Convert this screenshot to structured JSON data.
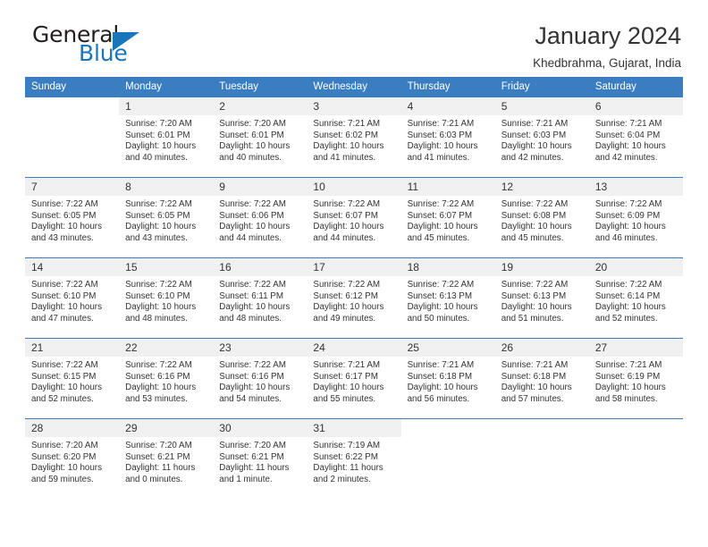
{
  "brand": {
    "name_part1": "General",
    "name_part2": "Blue"
  },
  "header": {
    "title": "January 2024",
    "subtitle": "Khedbrahma, Gujarat, India"
  },
  "colors": {
    "header_blue": "#3a7ec1",
    "brand_blue": "#1b75bb",
    "daynum_bg": "#f0f0f0",
    "text": "#333333"
  },
  "weekdays": [
    "Sunday",
    "Monday",
    "Tuesday",
    "Wednesday",
    "Thursday",
    "Friday",
    "Saturday"
  ],
  "weeks": [
    [
      {
        "day": "",
        "sunrise": "",
        "sunset": "",
        "daylight1": "",
        "daylight2": ""
      },
      {
        "day": "1",
        "sunrise": "Sunrise: 7:20 AM",
        "sunset": "Sunset: 6:01 PM",
        "daylight1": "Daylight: 10 hours",
        "daylight2": "and 40 minutes."
      },
      {
        "day": "2",
        "sunrise": "Sunrise: 7:20 AM",
        "sunset": "Sunset: 6:01 PM",
        "daylight1": "Daylight: 10 hours",
        "daylight2": "and 40 minutes."
      },
      {
        "day": "3",
        "sunrise": "Sunrise: 7:21 AM",
        "sunset": "Sunset: 6:02 PM",
        "daylight1": "Daylight: 10 hours",
        "daylight2": "and 41 minutes."
      },
      {
        "day": "4",
        "sunrise": "Sunrise: 7:21 AM",
        "sunset": "Sunset: 6:03 PM",
        "daylight1": "Daylight: 10 hours",
        "daylight2": "and 41 minutes."
      },
      {
        "day": "5",
        "sunrise": "Sunrise: 7:21 AM",
        "sunset": "Sunset: 6:03 PM",
        "daylight1": "Daylight: 10 hours",
        "daylight2": "and 42 minutes."
      },
      {
        "day": "6",
        "sunrise": "Sunrise: 7:21 AM",
        "sunset": "Sunset: 6:04 PM",
        "daylight1": "Daylight: 10 hours",
        "daylight2": "and 42 minutes."
      }
    ],
    [
      {
        "day": "7",
        "sunrise": "Sunrise: 7:22 AM",
        "sunset": "Sunset: 6:05 PM",
        "daylight1": "Daylight: 10 hours",
        "daylight2": "and 43 minutes."
      },
      {
        "day": "8",
        "sunrise": "Sunrise: 7:22 AM",
        "sunset": "Sunset: 6:05 PM",
        "daylight1": "Daylight: 10 hours",
        "daylight2": "and 43 minutes."
      },
      {
        "day": "9",
        "sunrise": "Sunrise: 7:22 AM",
        "sunset": "Sunset: 6:06 PM",
        "daylight1": "Daylight: 10 hours",
        "daylight2": "and 44 minutes."
      },
      {
        "day": "10",
        "sunrise": "Sunrise: 7:22 AM",
        "sunset": "Sunset: 6:07 PM",
        "daylight1": "Daylight: 10 hours",
        "daylight2": "and 44 minutes."
      },
      {
        "day": "11",
        "sunrise": "Sunrise: 7:22 AM",
        "sunset": "Sunset: 6:07 PM",
        "daylight1": "Daylight: 10 hours",
        "daylight2": "and 45 minutes."
      },
      {
        "day": "12",
        "sunrise": "Sunrise: 7:22 AM",
        "sunset": "Sunset: 6:08 PM",
        "daylight1": "Daylight: 10 hours",
        "daylight2": "and 45 minutes."
      },
      {
        "day": "13",
        "sunrise": "Sunrise: 7:22 AM",
        "sunset": "Sunset: 6:09 PM",
        "daylight1": "Daylight: 10 hours",
        "daylight2": "and 46 minutes."
      }
    ],
    [
      {
        "day": "14",
        "sunrise": "Sunrise: 7:22 AM",
        "sunset": "Sunset: 6:10 PM",
        "daylight1": "Daylight: 10 hours",
        "daylight2": "and 47 minutes."
      },
      {
        "day": "15",
        "sunrise": "Sunrise: 7:22 AM",
        "sunset": "Sunset: 6:10 PM",
        "daylight1": "Daylight: 10 hours",
        "daylight2": "and 48 minutes."
      },
      {
        "day": "16",
        "sunrise": "Sunrise: 7:22 AM",
        "sunset": "Sunset: 6:11 PM",
        "daylight1": "Daylight: 10 hours",
        "daylight2": "and 48 minutes."
      },
      {
        "day": "17",
        "sunrise": "Sunrise: 7:22 AM",
        "sunset": "Sunset: 6:12 PM",
        "daylight1": "Daylight: 10 hours",
        "daylight2": "and 49 minutes."
      },
      {
        "day": "18",
        "sunrise": "Sunrise: 7:22 AM",
        "sunset": "Sunset: 6:13 PM",
        "daylight1": "Daylight: 10 hours",
        "daylight2": "and 50 minutes."
      },
      {
        "day": "19",
        "sunrise": "Sunrise: 7:22 AM",
        "sunset": "Sunset: 6:13 PM",
        "daylight1": "Daylight: 10 hours",
        "daylight2": "and 51 minutes."
      },
      {
        "day": "20",
        "sunrise": "Sunrise: 7:22 AM",
        "sunset": "Sunset: 6:14 PM",
        "daylight1": "Daylight: 10 hours",
        "daylight2": "and 52 minutes."
      }
    ],
    [
      {
        "day": "21",
        "sunrise": "Sunrise: 7:22 AM",
        "sunset": "Sunset: 6:15 PM",
        "daylight1": "Daylight: 10 hours",
        "daylight2": "and 52 minutes."
      },
      {
        "day": "22",
        "sunrise": "Sunrise: 7:22 AM",
        "sunset": "Sunset: 6:16 PM",
        "daylight1": "Daylight: 10 hours",
        "daylight2": "and 53 minutes."
      },
      {
        "day": "23",
        "sunrise": "Sunrise: 7:22 AM",
        "sunset": "Sunset: 6:16 PM",
        "daylight1": "Daylight: 10 hours",
        "daylight2": "and 54 minutes."
      },
      {
        "day": "24",
        "sunrise": "Sunrise: 7:21 AM",
        "sunset": "Sunset: 6:17 PM",
        "daylight1": "Daylight: 10 hours",
        "daylight2": "and 55 minutes."
      },
      {
        "day": "25",
        "sunrise": "Sunrise: 7:21 AM",
        "sunset": "Sunset: 6:18 PM",
        "daylight1": "Daylight: 10 hours",
        "daylight2": "and 56 minutes."
      },
      {
        "day": "26",
        "sunrise": "Sunrise: 7:21 AM",
        "sunset": "Sunset: 6:18 PM",
        "daylight1": "Daylight: 10 hours",
        "daylight2": "and 57 minutes."
      },
      {
        "day": "27",
        "sunrise": "Sunrise: 7:21 AM",
        "sunset": "Sunset: 6:19 PM",
        "daylight1": "Daylight: 10 hours",
        "daylight2": "and 58 minutes."
      }
    ],
    [
      {
        "day": "28",
        "sunrise": "Sunrise: 7:20 AM",
        "sunset": "Sunset: 6:20 PM",
        "daylight1": "Daylight: 10 hours",
        "daylight2": "and 59 minutes."
      },
      {
        "day": "29",
        "sunrise": "Sunrise: 7:20 AM",
        "sunset": "Sunset: 6:21 PM",
        "daylight1": "Daylight: 11 hours",
        "daylight2": "and 0 minutes."
      },
      {
        "day": "30",
        "sunrise": "Sunrise: 7:20 AM",
        "sunset": "Sunset: 6:21 PM",
        "daylight1": "Daylight: 11 hours",
        "daylight2": "and 1 minute."
      },
      {
        "day": "31",
        "sunrise": "Sunrise: 7:19 AM",
        "sunset": "Sunset: 6:22 PM",
        "daylight1": "Daylight: 11 hours",
        "daylight2": "and 2 minutes."
      },
      {
        "day": "",
        "sunrise": "",
        "sunset": "",
        "daylight1": "",
        "daylight2": ""
      },
      {
        "day": "",
        "sunrise": "",
        "sunset": "",
        "daylight1": "",
        "daylight2": ""
      },
      {
        "day": "",
        "sunrise": "",
        "sunset": "",
        "daylight1": "",
        "daylight2": ""
      }
    ]
  ]
}
